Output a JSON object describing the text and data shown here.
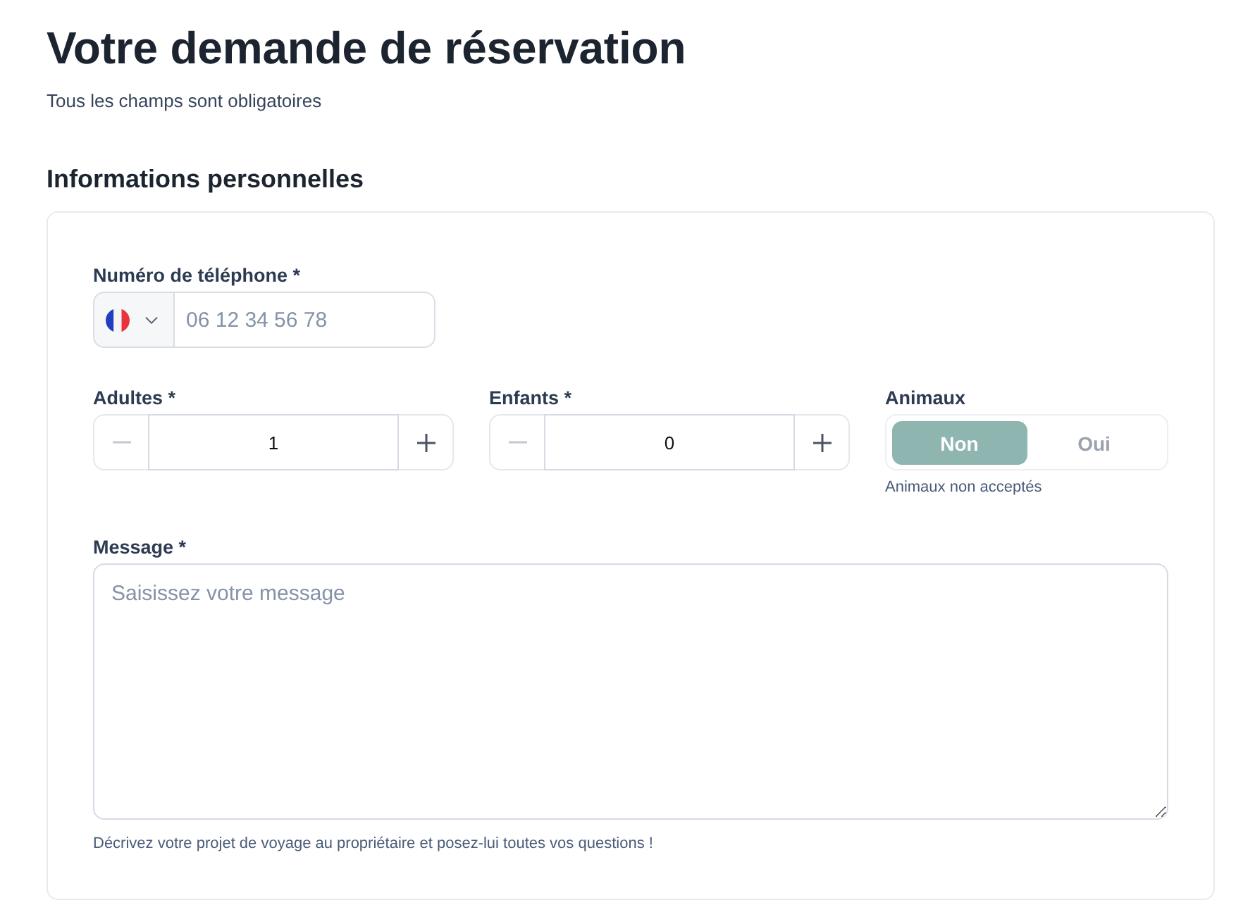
{
  "title": "Votre demande de réservation",
  "subtitle": "Tous les champs sont obligatoires",
  "section": {
    "heading": "Informations personnelles",
    "phone": {
      "label": "Numéro de téléphone *",
      "placeholder": "06 12 34 56 78"
    },
    "counters": [
      {
        "label": "Adultes *",
        "value": "1",
        "decrease_disabled": true,
        "increase_disabled": false
      },
      {
        "label": "Enfants *",
        "value": "0",
        "decrease_disabled": true,
        "increase_disabled": false
      }
    ],
    "animals": {
      "label": "Animaux",
      "disabled": true,
      "options": [
        {
          "label": "Non",
          "selected": true
        },
        {
          "label": "Oui",
          "selected": false
        }
      ],
      "hint": "Animaux non acceptés"
    },
    "message": {
      "label": "Message *",
      "placeholder": "Saisissez votre message",
      "hint": "Décrivez votre projet de voyage au propriétaire et posez-lui toutes vos questions !"
    }
  }
}
